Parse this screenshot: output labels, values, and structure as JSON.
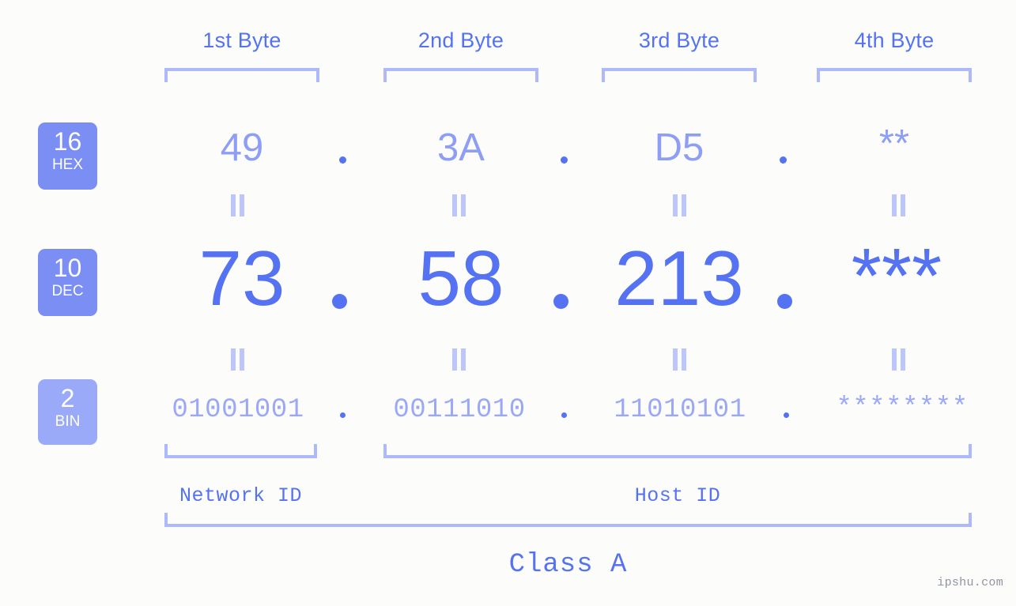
{
  "meta": {
    "background": "#fcfdfa",
    "accent": "#5572f2",
    "accent_light": "#8e9ef6",
    "accent_pale": "#aeb9fb",
    "badge_fill": "#7b8ef4",
    "badge_fill_light": "#9aaaf8"
  },
  "headers": [
    {
      "label": "1st Byte"
    },
    {
      "label": "2nd Byte"
    },
    {
      "label": "3rd Byte"
    },
    {
      "label": "4th Byte"
    }
  ],
  "bases": [
    {
      "number": "16",
      "name": "HEX"
    },
    {
      "number": "10",
      "name": "DEC"
    },
    {
      "number": "2",
      "name": "BIN"
    }
  ],
  "rows": {
    "hex": {
      "values": [
        "49",
        "3A",
        "D5",
        "**"
      ],
      "separator": "."
    },
    "dec": {
      "values": [
        "73",
        "58",
        "213",
        "***"
      ],
      "separator": "."
    },
    "bin": {
      "values": [
        "01001001",
        "00111010",
        "11010101",
        "********"
      ],
      "separator": "."
    }
  },
  "equals_marks": {
    "symbol": "=",
    "count_per_row": 4,
    "rows": 2
  },
  "segments": [
    {
      "label": "Network ID"
    },
    {
      "label": "Host ID"
    }
  ],
  "class": {
    "label": "Class A"
  },
  "watermark": {
    "text": "ipshu.com"
  }
}
